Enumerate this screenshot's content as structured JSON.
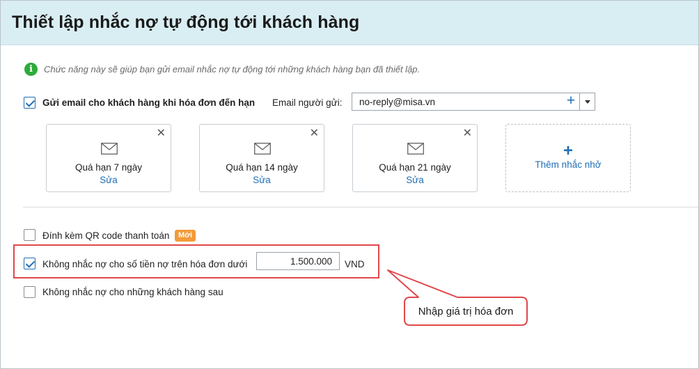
{
  "header": {
    "title": "Thiết lập nhắc nợ tự động tới khách hàng"
  },
  "info": {
    "text": "Chức năng này sẽ giúp bạn gửi email nhắc nợ tự động tới những khách hàng bạn đã thiết lập."
  },
  "send_email": {
    "label": "Gửi email cho khách hàng khi hóa đơn đến hạn",
    "checked": true,
    "sender_label": "Email người gửi:",
    "sender_value": "no-reply@misa.vn"
  },
  "reminders": [
    {
      "name": "Quá hạn 7 ngày",
      "edit": "Sửa"
    },
    {
      "name": "Quá hạn 14 ngày",
      "edit": "Sửa"
    },
    {
      "name": "Quá hạn 21 ngày",
      "edit": "Sửa"
    }
  ],
  "add_reminder": {
    "plus": "+",
    "label": "Thêm nhắc nhở"
  },
  "options": {
    "qr": {
      "label": "Đính kèm QR code thanh toán",
      "badge": "Mới",
      "checked": false
    },
    "min_amount": {
      "label": "Không nhắc nợ cho số tiền nợ trên hóa đơn dưới",
      "value": "1.500.000",
      "unit": "VND",
      "checked": true
    },
    "exclude_customers": {
      "label": "Không nhắc nợ cho những khách hàng sau",
      "checked": false
    }
  },
  "callout": {
    "text": "Nhập giá trị hóa đơn"
  },
  "colors": {
    "header_bg": "#d9eef3",
    "accent": "#1f6fb5",
    "highlight": "#e0484a",
    "badge": "#f39a38",
    "info_icon": "#2eaa3a"
  }
}
